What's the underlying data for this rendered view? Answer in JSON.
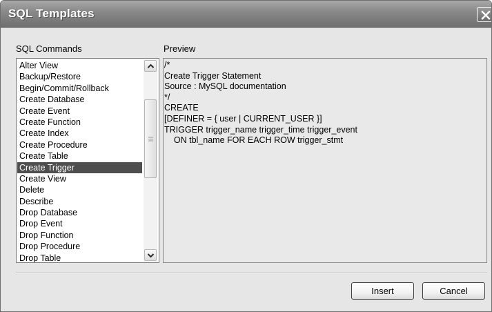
{
  "window": {
    "title": "SQL Templates"
  },
  "commands": {
    "label": "SQL Commands",
    "selected_index": 9,
    "items": [
      "Alter View",
      "Backup/Restore",
      "Begin/Commit/Rollback",
      "Create Database",
      "Create Event",
      "Create Function",
      "Create Index",
      "Create Procedure",
      "Create Table",
      "Create Trigger",
      "Create View",
      "Delete",
      "Describe",
      "Drop Database",
      "Drop Event",
      "Drop Function",
      "Drop Procedure",
      "Drop Table"
    ]
  },
  "preview": {
    "label": "Preview",
    "text": "/*\nCreate Trigger Statement\nSource : MySQL documentation\n*/\nCREATE\n[DEFINER = { user | CURRENT_USER }]\nTRIGGER trigger_name trigger_time trigger_event\n    ON tbl_name FOR EACH ROW trigger_stmt"
  },
  "buttons": {
    "insert": "Insert",
    "cancel": "Cancel"
  },
  "icons": {
    "close": "close-icon",
    "scroll_up": "arrow-up-icon",
    "scroll_down": "arrow-down-icon",
    "thumb_grip": "grip-icon"
  }
}
